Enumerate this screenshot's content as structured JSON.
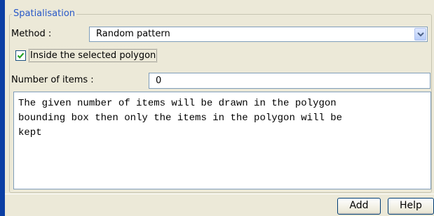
{
  "panel": {
    "legend": "Spatialisation"
  },
  "method": {
    "label": "Method :",
    "value": "Random pattern",
    "dropdown_icon": "chevron-down-icon"
  },
  "inside_polygon": {
    "label": "Inside the selected polygon",
    "checked": true
  },
  "items": {
    "label": "Number of items :",
    "value": "0"
  },
  "description": {
    "text": "The given number of items will be drawn in the polygon\nbounding box then only the items in the polygon will be\nkept"
  },
  "buttons": {
    "add_label": "Add",
    "help_label": "Help"
  },
  "colors": {
    "accent": "#2858c8",
    "window_bg": "#ece9d8",
    "sidebar": "#0b3fa4"
  }
}
